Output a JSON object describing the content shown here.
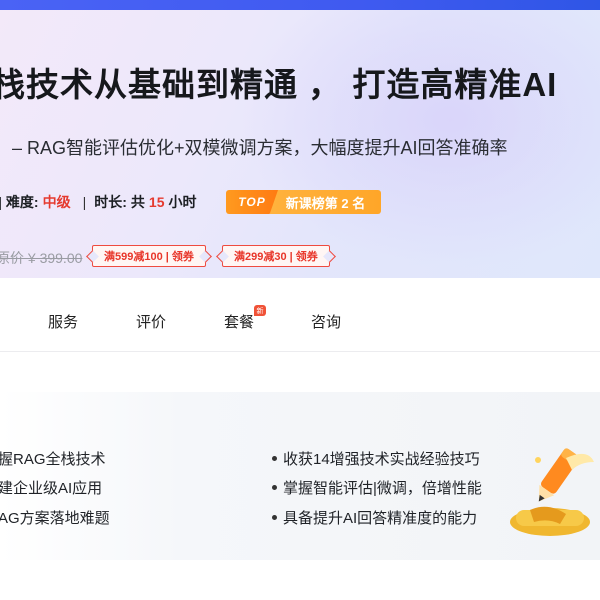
{
  "hero": {
    "title": "栈技术从基础到精通 ， 打造高精准AI",
    "subtitle": "– RAG智能评估优化+双模微调方案，大幅度提升AI回答准确率",
    "meta": {
      "difficulty_label": "难度:",
      "difficulty_value": "中级",
      "separator": "|",
      "duration_label": "时长:",
      "duration_prefix": "共",
      "duration_value": "15",
      "duration_unit": "小时"
    },
    "rank_badge": {
      "tag": "TOP",
      "text": "新课榜第 2 名"
    },
    "original_price": "原价 ¥ 399.00",
    "coupons": [
      {
        "label": "满599减100 | 领券"
      },
      {
        "label": "满299减30 | 领券"
      }
    ]
  },
  "tabs": {
    "items": [
      {
        "label": "服务"
      },
      {
        "label": "评价"
      },
      {
        "label": "套餐"
      },
      {
        "label": "咨询"
      }
    ],
    "new_badge": "新"
  },
  "benefits": {
    "left": [
      "握RAG全栈技术",
      "建企业级AI应用",
      "AG方案落地难题"
    ],
    "right": [
      "收获14增强技术实战经验技巧",
      "掌握智能评估|微调，倍增性能",
      "具备提升AI回答精准度的能力"
    ]
  },
  "colors": {
    "accent_red": "#e53a2f",
    "rank_orange": "#ff9a1f",
    "top_bar_blue": "#4a63f5",
    "hero_bg": "#ece8fb"
  }
}
